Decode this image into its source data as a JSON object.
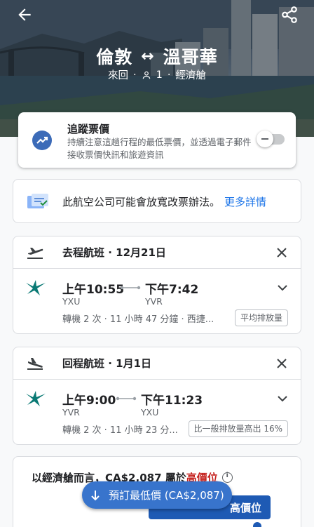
{
  "hero": {
    "origin": "倫敦",
    "destination": "溫哥華",
    "swap_symbol": "↔",
    "trip_type": "來回",
    "passengers": "1",
    "cabin": "經濟艙",
    "separator": "·"
  },
  "tracker": {
    "title": "追蹤票價",
    "description": "持續注意這趟行程的最低票價，並透過電子郵件接收票價快訊和旅遊資訊",
    "enabled": false
  },
  "notice": {
    "text": "此航空公司可能會放寬改票辦法。",
    "link": "更多詳情"
  },
  "outbound": {
    "label": "去程航班 · 12月21日",
    "depart_time": "上午10:55",
    "arrive_time": "下午7:42",
    "depart_code": "YXU",
    "arrive_code": "YVR",
    "meta": "轉機 2 次 · 11 小時 47 分鐘 · 西捷...",
    "emissions": "平均排放量"
  },
  "return": {
    "label": "回程航班 · 1月1日",
    "depart_time": "上午9:00",
    "arrive_time": "下午11:23",
    "depart_code": "YVR",
    "arrive_code": "YXU",
    "meta": "轉機 2 次 · 11 小時 23 分...",
    "emissions": "比一般排放量高出 16%"
  },
  "price": {
    "prefix": "以經濟艙而言，CA$2,087 屬於",
    "level": "高價位",
    "tooltip": "高價位"
  },
  "fab": {
    "label": "預訂最低價 (CA$2,087)"
  },
  "colors": {
    "accent": "#1a73e8",
    "fab": "#3874cc",
    "high_price": "#c5221f",
    "airline": "#0b7a75"
  }
}
